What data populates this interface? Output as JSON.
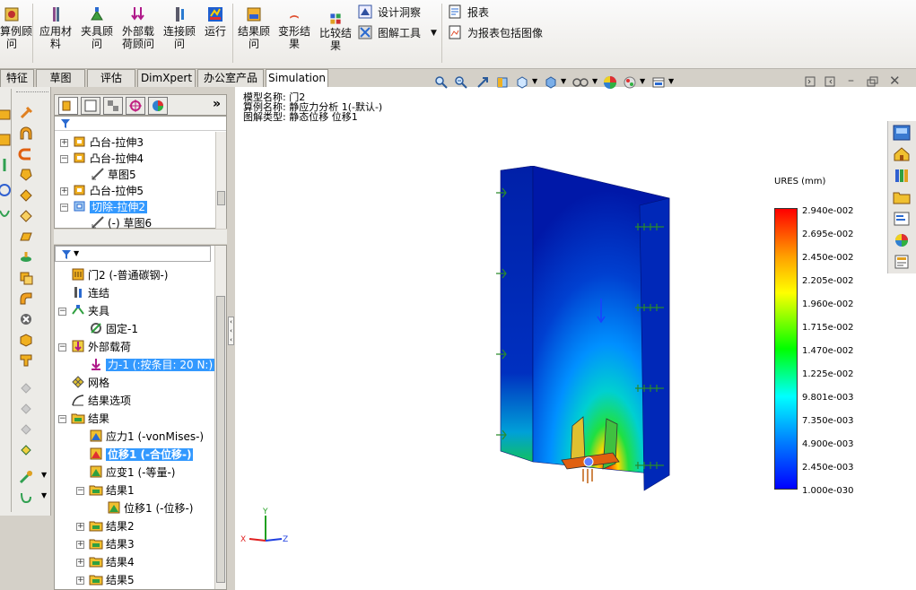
{
  "ribbon": {
    "buttons": [
      {
        "label": "算例顾\n问",
        "icon": "study-advisor-icon"
      },
      {
        "label": "应用材\n料",
        "icon": "apply-material-icon"
      },
      {
        "label": "夹具顾\n问",
        "icon": "fixtures-advisor-icon"
      },
      {
        "label": "外部载\n荷顾问",
        "icon": "external-loads-advisor-icon"
      },
      {
        "label": "连接顾\n问",
        "icon": "connections-advisor-icon"
      },
      {
        "label": "运行",
        "icon": "run-icon"
      },
      {
        "label": "结果顾\n问",
        "icon": "results-advisor-icon"
      },
      {
        "label": "变形结\n果",
        "icon": "deformed-result-icon"
      },
      {
        "label": "比较结\n果",
        "icon": "compare-results-icon"
      }
    ],
    "small_buttons": [
      {
        "label": "设计洞察",
        "icon": "design-insight-icon"
      },
      {
        "label": "图解工具",
        "icon": "plot-tools-icon"
      },
      {
        "label": "报表",
        "icon": "report-icon"
      },
      {
        "label": "为报表包括图像",
        "icon": "include-image-icon"
      }
    ]
  },
  "tabs": [
    "特征",
    "草图",
    "评估",
    "DimXpert",
    "办公室产品",
    "Simulation"
  ],
  "feature_tree": [
    {
      "label": "凸台-拉伸3",
      "icon": "extrude-icon"
    },
    {
      "label": "凸台-拉伸4",
      "icon": "extrude-icon"
    },
    {
      "label": "草图5",
      "icon": "sketch-icon"
    },
    {
      "label": "凸台-拉伸5",
      "icon": "extrude-icon"
    },
    {
      "label": "切除-拉伸2",
      "icon": "cut-extrude-icon"
    },
    {
      "label": "(-) 草图6",
      "icon": "sketch-icon"
    }
  ],
  "sim_tree": [
    {
      "label": "门2 (-普通碳钢-)"
    },
    {
      "label": "连结"
    },
    {
      "label": "夹具"
    },
    {
      "label": "固定-1"
    },
    {
      "label": "外部载荷"
    },
    {
      "label": "力-1 (:按条目: 20 N:)"
    },
    {
      "label": "网格"
    },
    {
      "label": "结果选项"
    },
    {
      "label": "结果"
    },
    {
      "label": "应力1 (-vonMises-)"
    },
    {
      "label": "位移1 (-合位移-)"
    },
    {
      "label": "应变1 (-等量-)"
    },
    {
      "label": "结果1"
    },
    {
      "label": "位移1 (-位移-)"
    },
    {
      "label": "结果2"
    },
    {
      "label": "结果3"
    },
    {
      "label": "结果4"
    },
    {
      "label": "结果5"
    }
  ],
  "viewport": {
    "info_lines": [
      "模型名称: 门2",
      "算例名称: 静应力分析 1(-默认-)",
      "图解类型: 静态位移 位移1"
    ],
    "legend_title": "URES (mm)",
    "legend_values": [
      "2.940e-002",
      "2.695e-002",
      "2.450e-002",
      "2.205e-002",
      "1.960e-002",
      "1.715e-002",
      "1.470e-002",
      "1.225e-002",
      "9.801e-003",
      "7.350e-003",
      "4.900e-003",
      "2.450e-003",
      "1.000e-030"
    ],
    "axes": [
      "X",
      "Y",
      "Z"
    ]
  },
  "colors": {
    "selection": "#3399ff",
    "legend_max": "#ff0000",
    "legend_min": "#0000ff"
  }
}
